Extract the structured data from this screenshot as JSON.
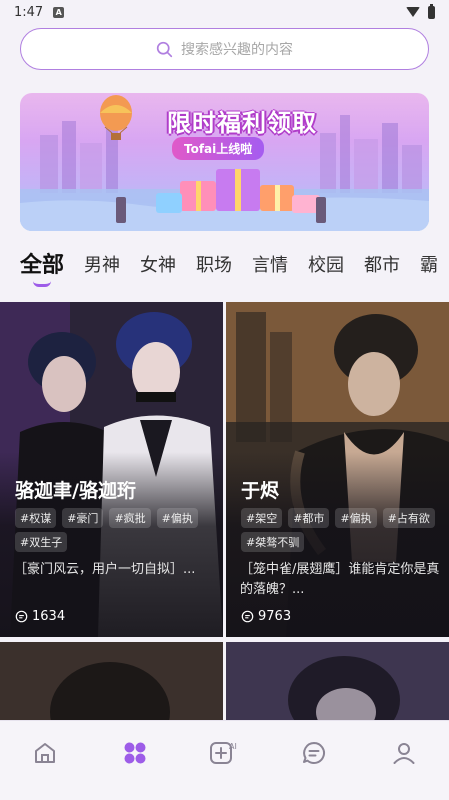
{
  "status_bar": {
    "time": "1:47",
    "notification_glyph": "A"
  },
  "search": {
    "placeholder": "搜索感兴趣的内容"
  },
  "banner": {
    "title": "限时福利领取",
    "subtitle": "Tofai上线啦"
  },
  "tabs": [
    {
      "label": "全部",
      "active": true
    },
    {
      "label": "男神"
    },
    {
      "label": "女神"
    },
    {
      "label": "职场"
    },
    {
      "label": "言情"
    },
    {
      "label": "校园"
    },
    {
      "label": "都市"
    },
    {
      "label": "霸"
    }
  ],
  "cards": [
    {
      "name": "骆迦聿/骆迦珩",
      "tags": [
        "#权谋",
        "#豪门",
        "#疯批",
        "#偏执",
        "#双生子"
      ],
      "desc": "［豪门风云，用户一切自拟］...",
      "count": "1634"
    },
    {
      "name": "于烬",
      "tags": [
        "#架空",
        "#都市",
        "#偏执",
        "#占有欲",
        "#桀骜不驯"
      ],
      "desc": "［笼中雀/展翅鹰］谁能肯定你是真的落魄？...",
      "count": "9763"
    }
  ],
  "bottom_nav": [
    {
      "icon": "home-icon"
    },
    {
      "icon": "discover-grid-icon",
      "active": true
    },
    {
      "icon": "ai-create-icon",
      "badge": "AI"
    },
    {
      "icon": "chat-icon"
    },
    {
      "icon": "profile-icon"
    }
  ],
  "colors": {
    "accent": "#9d5ce8",
    "search_border": "#b07fe0"
  }
}
